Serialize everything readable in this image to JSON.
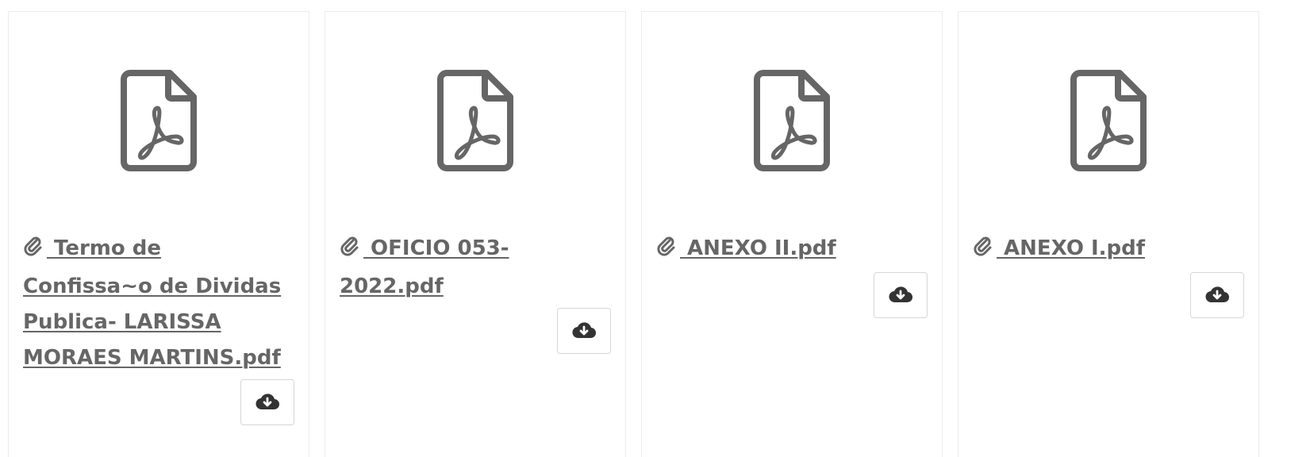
{
  "attachments": [
    {
      "file_name": " Termo de Confissa~o de Dividas Publica- LARISSA MORAES MARTINS.pdf",
      "icon": "file-pdf-icon"
    },
    {
      "file_name": " OFICIO 053-2022.pdf",
      "icon": "file-pdf-icon"
    },
    {
      "file_name": " ANEXO II.pdf",
      "icon": "file-pdf-icon"
    },
    {
      "file_name": " ANEXO I.pdf",
      "icon": "file-pdf-icon"
    }
  ],
  "icons": {
    "link": "paperclip-icon",
    "download": "cloud-download-icon"
  },
  "colors": {
    "icon": "#666666",
    "link": "#666666",
    "border": "#ececec",
    "button_border": "#d6d6d6"
  }
}
